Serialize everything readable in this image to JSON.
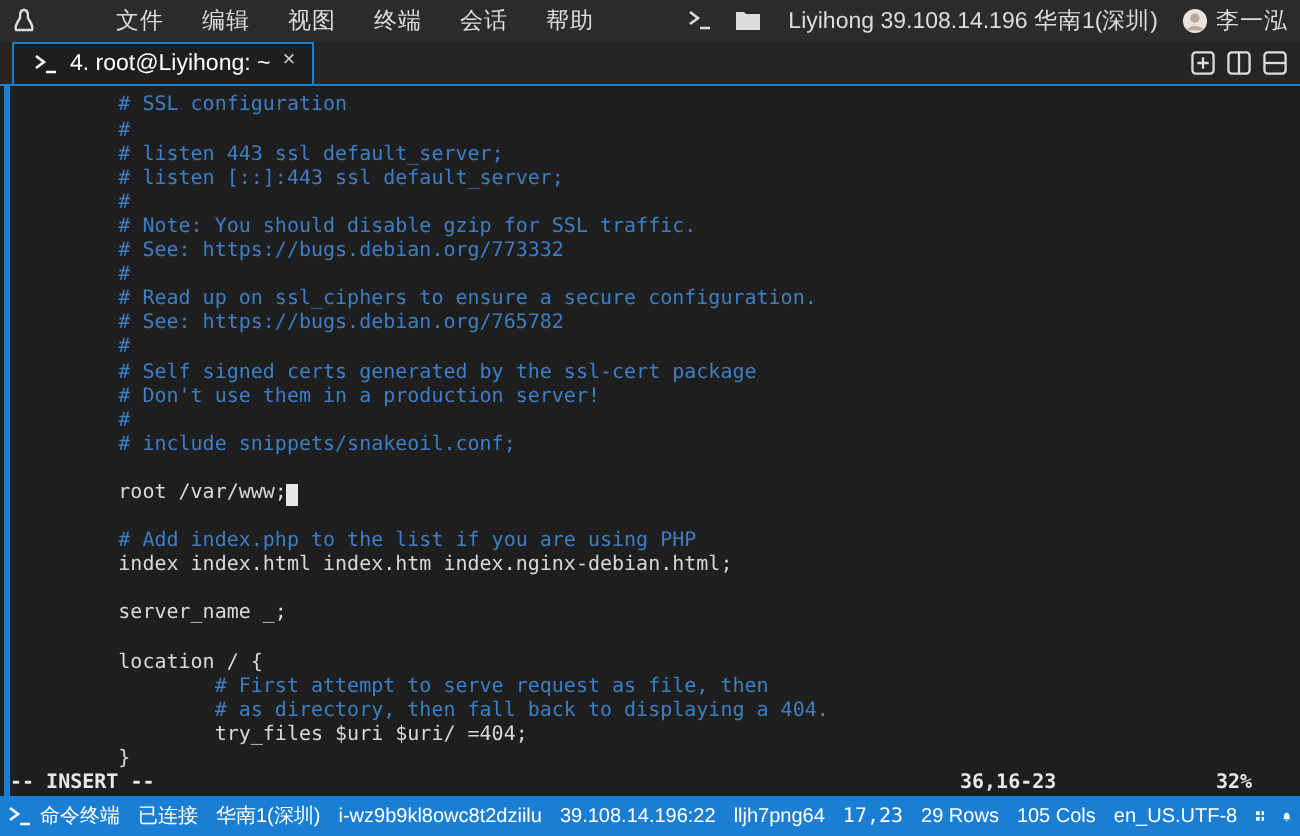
{
  "menu_bar": {
    "items": [
      "文件",
      "编辑",
      "视图",
      "终端",
      "会话",
      "帮助"
    ],
    "host": "Liyihong 39.108.14.196 华南1(深圳)",
    "user": "李一泓"
  },
  "tabs": [
    {
      "label": "4. root@Liyihong: ~",
      "selected": true,
      "close": "×"
    }
  ],
  "terminal": {
    "lines": [
      {
        "kind": "comment",
        "text": "        # SSL configuration",
        "cursor": false
      },
      {
        "kind": "comment",
        "text": "        #",
        "cursor": false
      },
      {
        "kind": "comment",
        "text": "        # listen 443 ssl default_server;",
        "cursor": false
      },
      {
        "kind": "comment",
        "text": "        # listen [::]:443 ssl default_server;",
        "cursor": false
      },
      {
        "kind": "comment",
        "text": "        #",
        "cursor": false
      },
      {
        "kind": "comment",
        "text": "        # Note: You should disable gzip for SSL traffic.",
        "cursor": false
      },
      {
        "kind": "comment",
        "text": "        # See: https://bugs.debian.org/773332",
        "cursor": false
      },
      {
        "kind": "comment",
        "text": "        #",
        "cursor": false
      },
      {
        "kind": "comment",
        "text": "        # Read up on ssl_ciphers to ensure a secure configuration.",
        "cursor": false
      },
      {
        "kind": "comment",
        "text": "        # See: https://bugs.debian.org/765782",
        "cursor": false
      },
      {
        "kind": "comment",
        "text": "        #",
        "cursor": false
      },
      {
        "kind": "comment",
        "text": "        # Self signed certs generated by the ssl-cert package",
        "cursor": false
      },
      {
        "kind": "comment",
        "text": "        # Don't use them in a production server!",
        "cursor": false
      },
      {
        "kind": "comment",
        "text": "        #",
        "cursor": false
      },
      {
        "kind": "comment",
        "text": "        # include snippets/snakeoil.conf;",
        "cursor": false
      },
      {
        "kind": "blank",
        "cursor": false
      },
      {
        "kind": "code",
        "text": "        root /var/www;",
        "cursor": true
      },
      {
        "kind": "blank",
        "cursor": false
      },
      {
        "kind": "comment",
        "text": "        # Add index.php to the list if you are using PHP",
        "cursor": false
      },
      {
        "kind": "code",
        "text": "        index index.html index.htm index.nginx-debian.html;",
        "cursor": false
      },
      {
        "kind": "blank",
        "cursor": false
      },
      {
        "kind": "code",
        "text": "        server_name _;",
        "cursor": false
      },
      {
        "kind": "blank",
        "cursor": false
      },
      {
        "kind": "code",
        "text": "        location / {",
        "cursor": false
      },
      {
        "kind": "comment",
        "text": "                # First attempt to serve request as file, then",
        "cursor": false
      },
      {
        "kind": "comment",
        "text": "                # as directory, then fall back to displaying a 404.",
        "cursor": false
      },
      {
        "kind": "code",
        "text": "                try_files $uri $uri/ =404;",
        "cursor": false
      },
      {
        "kind": "code",
        "text": "        }",
        "cursor": false
      }
    ],
    "mode": "-- INSERT --",
    "position": "36,16-23",
    "percent": "32%"
  },
  "status_bar": {
    "terminal": "命令终端",
    "connection": "已连接",
    "region": "华南1(深圳)",
    "instance": "i-wz9b9kl8owc8t2dziilu",
    "address": "39.108.14.196:22",
    "session": "lljh7png64",
    "cursor": "17,23",
    "rows": "29 Rows",
    "cols": "105 Cols",
    "encoding": "en_US.UTF-8"
  }
}
